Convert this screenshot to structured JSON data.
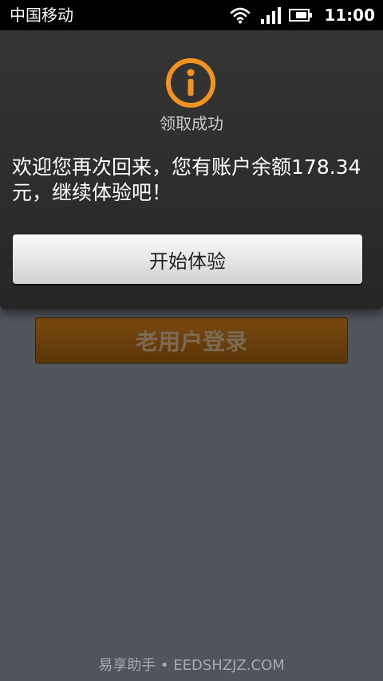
{
  "status_bar": {
    "carrier": "中国移动",
    "time": "11:00",
    "icons": [
      "wifi-icon",
      "signal-icon",
      "battery-icon"
    ]
  },
  "dialog": {
    "icon": "info-icon",
    "title": "领取成功",
    "message": "欢迎您再次回来，您有账户余额178.34元，继续体验吧！",
    "button_label": "开始体验"
  },
  "background": {
    "button_label": "老用户登录"
  },
  "watermark": "易享助手 • EEDSHZJZ.COM",
  "colors": {
    "accent": "#f19321",
    "dialog_bg": "#2d2d2d",
    "page_bg": "#50555b",
    "backdrop_button": "#6b420d"
  }
}
